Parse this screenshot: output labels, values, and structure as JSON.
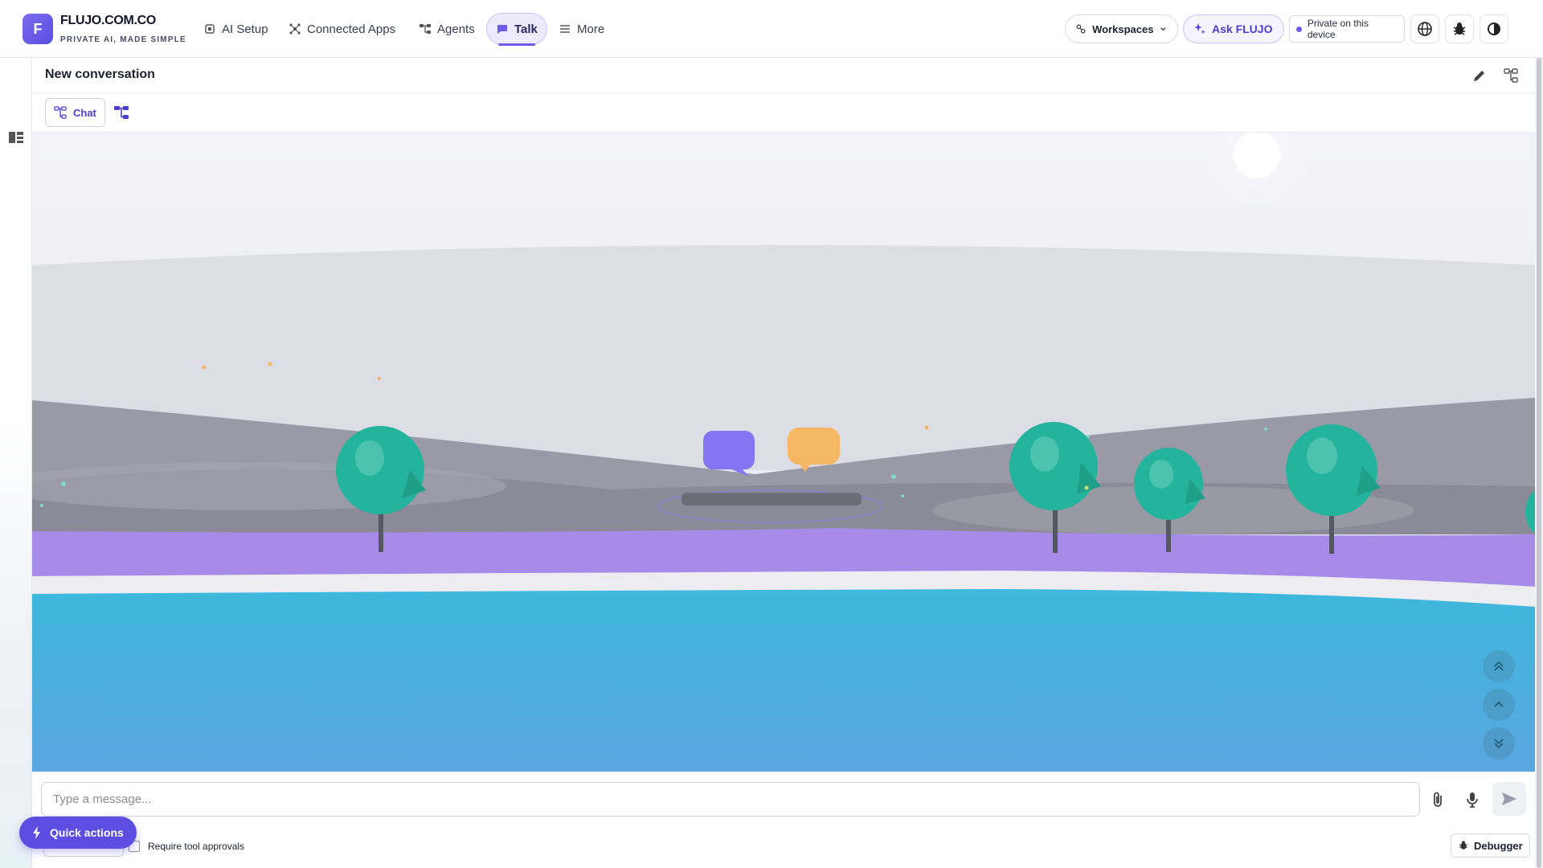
{
  "brand": {
    "logo_letter": "F",
    "name": "FLUJO.COM.CO",
    "tagline": "PRIVATE AI, MADE SIMPLE"
  },
  "nav": {
    "items": [
      {
        "label": "AI Setup",
        "icon": "cpu-icon"
      },
      {
        "label": "Connected Apps",
        "icon": "connections-icon"
      },
      {
        "label": "Agents",
        "icon": "flow-icon"
      },
      {
        "label": "Talk",
        "icon": "chat-bubble-icon",
        "active": true
      },
      {
        "label": "More",
        "icon": "menu-icon"
      }
    ]
  },
  "header_right": {
    "workspaces_label": "Workspaces",
    "ask_label": "Ask FLUJO",
    "privacy_label": "Private on this device"
  },
  "conversation": {
    "title": "New conversation"
  },
  "tabs": {
    "chat_label": "Chat"
  },
  "composer": {
    "placeholder": "Type a message...",
    "value": "",
    "approval_label": "Require tool approvals",
    "debugger_label": "Debugger"
  },
  "quick_actions": {
    "label": "Quick actions"
  },
  "colors": {
    "accent": "#6c5ce7",
    "accent_dark": "#5b4ee0",
    "water": "#3db8dc",
    "trees": "#24b39c",
    "ground_purple": "#a78be8"
  }
}
